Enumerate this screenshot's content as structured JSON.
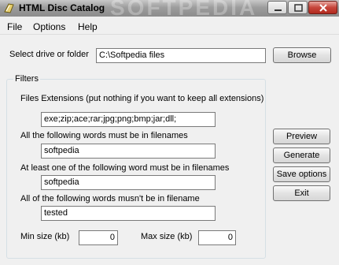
{
  "window": {
    "title": "HTML Disc Catalog",
    "watermark": "SOFTPEDIA"
  },
  "menu": {
    "items": [
      "File",
      "Options",
      "Help"
    ]
  },
  "source": {
    "label": "Select drive or folder",
    "value": "C:\\Softpedia files",
    "browse_label": "Browse"
  },
  "filters": {
    "legend": "Filters",
    "extensions_label": "Files Extensions  (put nothing if you want to keep all extensions)",
    "extensions_value": "exe;zip;ace;rar;jpg;png;bmp;jar;dll;",
    "all_words_label": "All the following words must be in filenames",
    "all_words_value": "softpedia",
    "any_word_label": "At least one of the following word must be in filenames",
    "any_word_value": "softpedia",
    "none_words_label": "All of the following words musn't be in filename",
    "none_words_value": "tested",
    "min_size_label": "Min size (kb)",
    "min_size_value": "0",
    "max_size_label": "Max size (kb)",
    "max_size_value": "0"
  },
  "actions": {
    "preview": "Preview",
    "generate": "Generate",
    "save_options": "Save options",
    "exit": "Exit"
  }
}
